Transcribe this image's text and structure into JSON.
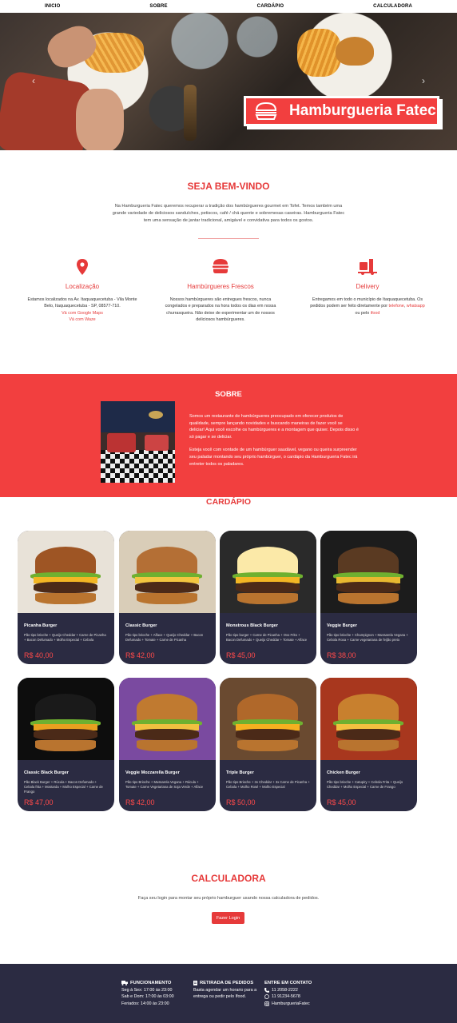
{
  "nav": [
    "INICIO",
    "SOBRE",
    "CARDÁPIO",
    "CALCULADORA"
  ],
  "hero": {
    "title": "Hamburgueria Fatec",
    "prev": "‹",
    "next": "›"
  },
  "welcome": {
    "title": "SEJA BEM-VINDO",
    "text": "Na Hamburgueria Fatec queremos recuperar a tradição dos hambúrgueres gourmet em Tofet. Temos também uma grande variedade de deliciosos sanduíches, petiscos, café / chá quente e sobremesas caseiras. Hamburgueria Fatec tem uma sensação de jantar tradicional, amigável e convidativa para todos os gostos."
  },
  "features": [
    {
      "title": "Localização",
      "text": "Estamos localizados na Av. Itaquaquecetuba - Vila Monte Belo, Itaquaquecetuba - SP, 08577-710.",
      "links": [
        "Vá com Google Maps",
        "Vá com Waze"
      ]
    },
    {
      "title": "Hambúrgueres Frescos",
      "text": "Nossos hambúrgueres são entregues frescos, nunca congelados e preparados na hora todos os dias em nossa churrasqueira. Não deixe de experimentar um de nossos deliciosos hambúrgueres."
    },
    {
      "title": "Delivery",
      "text_before": "Entregamos em todo o município de Itaquaquecetuba. Os pedidos podem ser feito diretamente por",
      "link1": "telefone",
      "sep1": ", ",
      "link2": "whatsapp",
      "mid": " ou pelo ",
      "link3": "ifood"
    }
  ],
  "sobre": {
    "title": "SOBRE",
    "p1": "Somos um restaurante de hambúrgueres preocupado em oferecer produtos de qualidade, sempre lançando novidades e buscando maneiras de fazer você se deliciar! Aqui você escolhe os hambúrgueres e a montagem que quiser. Depois disso é só pagar e se deliciar.",
    "p2": "Esteja você com vontade de um hambúrguer saudável, vegano ou queira surpreender seu paladar montando seu próprio hambúrguer, o cardápio da Hamburgueria Fatec irá entreter todos os paladares."
  },
  "cardapio": {
    "title": "CARDÁPIO",
    "items": [
      {
        "name": "Picanha Burger",
        "desc": "Pão tipo brioche + Queijo Cheddar + Carne de Picanha + Bacon Defumado + Molho Especial + Cebola",
        "price": "R$ 40,00",
        "top": "#9e5524",
        "bg": "#e8e2d8",
        "cheese": "#f2b624"
      },
      {
        "name": "Classic Burger",
        "desc": "Pão tipo brioche + Alface + Queijo Cheddar + Bacon Defumado + Tomate + Carne de Picanha",
        "price": "R$ 42,00",
        "top": "#b46f35",
        "bg": "#d9cdb8",
        "cheese": "#f2c640"
      },
      {
        "name": "Monstrous Black Burger",
        "desc": "Pão tipo burger + Carne de Picanha + Ovo Frito + Bacon Defumado + Queijo Cheddar + Tomate + Alface",
        "price": "R$ 45,00",
        "top": "#fbe9a8",
        "bg": "#2a2a2a",
        "cheese": "#f2b624"
      },
      {
        "name": "Veggie Burger",
        "desc": "Pão tipo brioche + Champignon + Mussarela Vegana + Cebola Roxa + Carne vegetariana de feijão preto",
        "price": "R$ 38,00",
        "top": "#5a3a22",
        "bg": "#1c1c1c",
        "cheese": "#e8b830"
      },
      {
        "name": "Classic Black Burger",
        "desc": "Pão Black Burger + Rúcula + Bacon Defumado + Cebola frita + Mostarda + Molho Especial + Carne de Frango",
        "price": "R$ 47,00",
        "top": "#1a1a1a",
        "bg": "#0d0d0d",
        "cheese": "#e8a020"
      },
      {
        "name": "Veggie Mozzarella Burger",
        "desc": "Pão tipo Brioche + Mussarela Vegana + Rúcula + Tomate + Carne Vegetariana de Soja Verde + Alface",
        "price": "R$ 42,00",
        "top": "#c07a30",
        "bg": "#7a4aa0",
        "cheese": "#f0c040"
      },
      {
        "name": "Triple Burger",
        "desc": "Pão tipo Brioche + 3x Cheddar + 3x Carne de Picanha + Cebola + Molho Rosé + Molho Especial",
        "price": "R$ 50,00",
        "top": "#b0682a",
        "bg": "#6a4a30",
        "cheese": "#f5b020"
      },
      {
        "name": "Chicken Burger",
        "desc": "Pão tipo brioche + Catupiry + Cebola Frita + Queijo Cheddar + Molho Especial + Carne de Frango",
        "price": "R$ 45,00",
        "top": "#c8802e",
        "bg": "#a8371e",
        "cheese": "#f2c040"
      }
    ]
  },
  "calculadora": {
    "title": "CALCULADORA",
    "text": "Faça seu login para montar seu próprio hamburguer usando nossa calculadora de pedidos.",
    "button": "Fazer Login"
  },
  "footer": {
    "col1_title": "FUNCIONAMENTO",
    "col1_lines": [
      "Seg à Sex: 17:00 às 23:00",
      "Sab e Dom: 17:00 às 03:00",
      "Feriados: 14:00 às 23:00"
    ],
    "col2_title": "RETIRADA DE PEDIDOS",
    "col2_text": "Basta agendar um horario para a entrega ou pedir pelo Ifood.",
    "col3_title": "ENTRE EM CONTATO",
    "phone": "11 2058-2222",
    "whatsapp": "11 91234-5678",
    "instagram": "HamburgueriaFatec"
  },
  "colors": {
    "accent": "#e63a3a",
    "dark": "#2b2b42"
  }
}
